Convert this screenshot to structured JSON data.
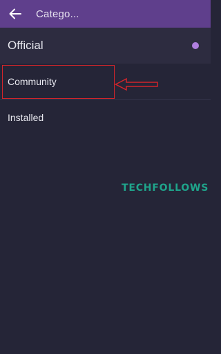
{
  "header": {
    "title": "Catego...",
    "back_icon": "arrow-left-icon",
    "background_color": "#5f3f8c"
  },
  "categories": [
    {
      "label": "Official",
      "selected": true,
      "indicator_color": "#b07fe0"
    },
    {
      "label": "Community",
      "selected": false,
      "highlighted": true
    },
    {
      "label": "Installed",
      "selected": false
    }
  ],
  "annotation": {
    "highlight_color": "#d2252b",
    "arrow_icon": "arrow-left-outline-icon"
  },
  "watermark": {
    "text": "TECHFOLLOWS",
    "color": "#1fa48b"
  }
}
